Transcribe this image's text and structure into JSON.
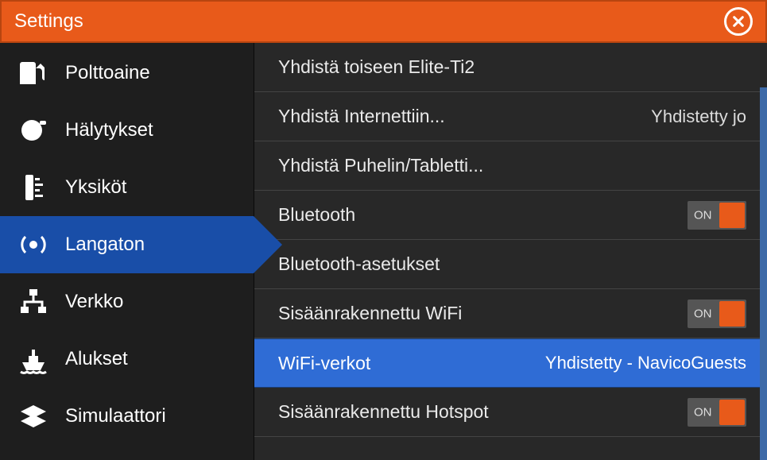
{
  "title": "Settings",
  "sidebar": {
    "items": [
      {
        "label": "Polttoaine"
      },
      {
        "label": "Hälytykset"
      },
      {
        "label": "Yksiköt"
      },
      {
        "label": "Langaton"
      },
      {
        "label": "Verkko"
      },
      {
        "label": "Alukset"
      },
      {
        "label": "Simulaattori"
      }
    ]
  },
  "content": {
    "rows": [
      {
        "label": "Yhdistä toiseen Elite-Ti2",
        "value": ""
      },
      {
        "label": "Yhdistä Internettiin...",
        "value": "Yhdistetty jo"
      },
      {
        "label": "Yhdistä Puhelin/Tabletti...",
        "value": ""
      },
      {
        "label": "Bluetooth",
        "toggle": "ON"
      },
      {
        "label": "Bluetooth-asetukset",
        "value": ""
      },
      {
        "label": "Sisäänrakennettu WiFi",
        "toggle": "ON"
      },
      {
        "label": "WiFi-verkot",
        "value": "Yhdistetty - NavicoGuests",
        "selected": true
      },
      {
        "label": "Sisäänrakennettu Hotspot",
        "toggle": "ON"
      }
    ]
  }
}
